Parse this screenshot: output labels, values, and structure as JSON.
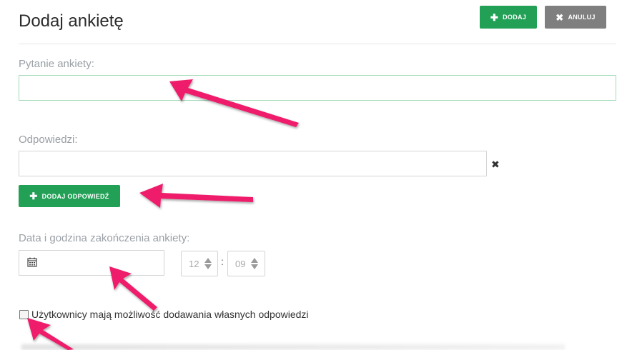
{
  "header": {
    "title": "Dodaj ankietę",
    "add_label": "DODAJ",
    "cancel_label": "ANULUJ"
  },
  "question": {
    "label": "Pytanie ankiety:",
    "value": ""
  },
  "answers": {
    "label": "Odpowiedzi:",
    "items": [
      ""
    ],
    "remove_glyph": "✖",
    "add_answer_label": "DODAJ ODPOWIEDŹ"
  },
  "end_date": {
    "label": "Data i godzina zakończenia ankiety:",
    "date_value": "",
    "hour": "12",
    "minute": "09",
    "separator": ":"
  },
  "options": {
    "allow_custom_answers_label": "Użytkownicy mają możliwość dodawania własnych odpowiedzi",
    "allow_custom_answers_checked": false
  },
  "colors": {
    "primary_green": "#21a056",
    "cancel_gray": "#7f7f7f",
    "annotation_pink": "#ee1f6b"
  },
  "icons": {
    "plus": "plus-icon",
    "close": "close-icon",
    "calendar": "calendar-icon"
  }
}
